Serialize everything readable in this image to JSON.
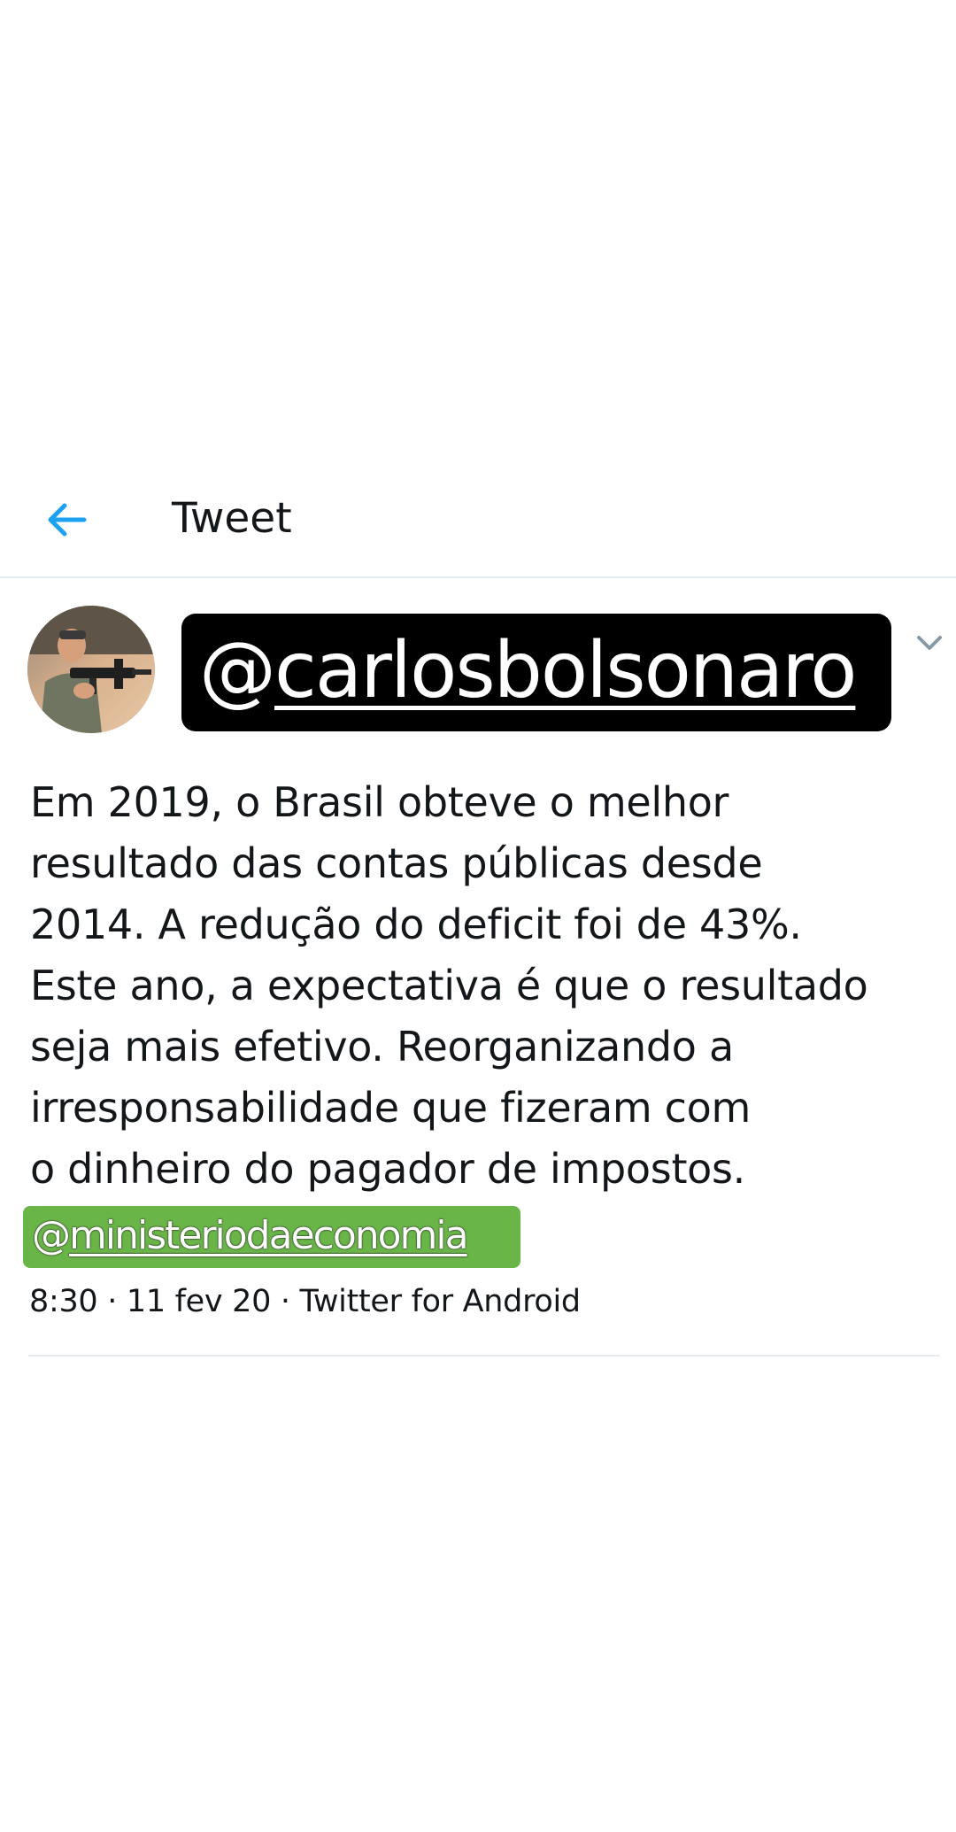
{
  "header": {
    "title": "Tweet",
    "back_icon": "arrow-left-icon",
    "accent_color": "#1da1f2"
  },
  "tweet": {
    "avatar_icon": "avatar-photo",
    "handle_at": "@",
    "handle_name": "carlosbolsonaro",
    "menu_icon": "chevron-down-icon",
    "text": "Em 2019, o Brasil obteve o melhor\nresultado das contas públicas desde\n2014. A redução do deficit foi de 43%.\nEste ano, a expectativa é que o resultado\nseja mais efetivo. Reorganizando a\nirresponsabilidade que fizeram com\no dinheiro do pagador de impostos.",
    "mention_at": "@",
    "mention_name": "ministeriodaeconomia",
    "mention_box_color": "#6ab548",
    "handle_box_color": "#000000",
    "meta": "8:30 · 11 fev 20 · Twitter for Android"
  }
}
